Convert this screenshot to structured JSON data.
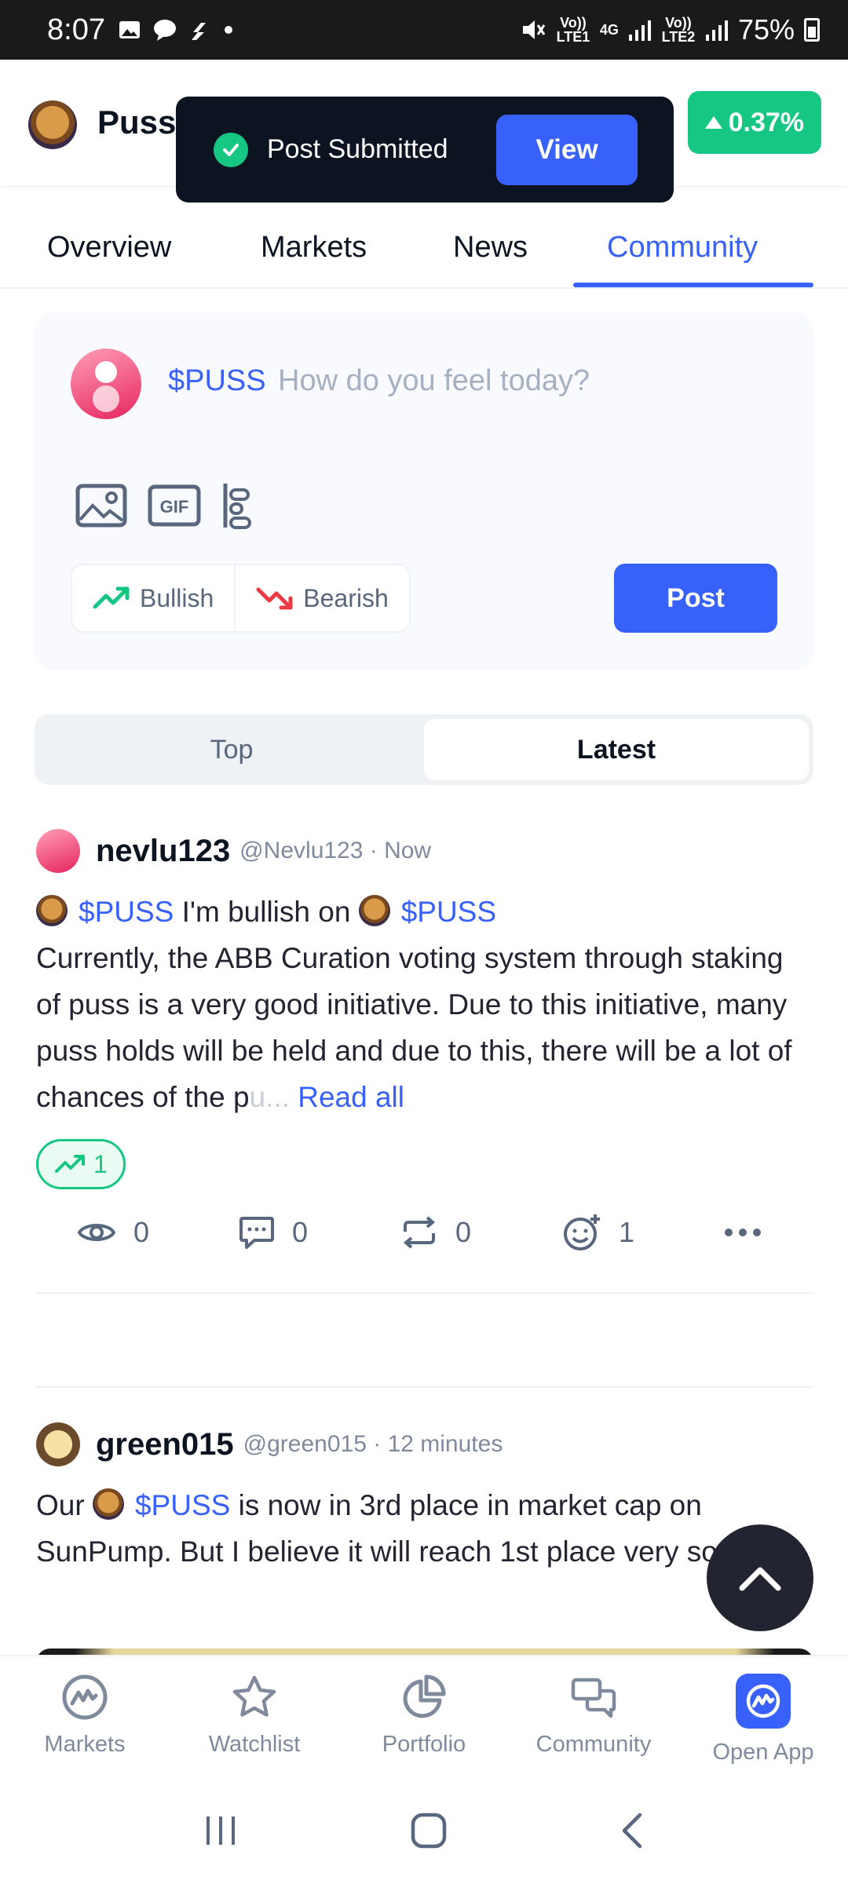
{
  "status_bar": {
    "time": "8:07",
    "signal1_label": "Vo)) LTE1",
    "net_label": "4G",
    "signal2_label": "Vo)) LTE2",
    "battery": "75%"
  },
  "header": {
    "coin_name": "Puss",
    "price_change": "0.37%",
    "change_color": "#16c784"
  },
  "toast": {
    "message": "Post Submitted",
    "action_label": "View"
  },
  "tabs": [
    "Overview",
    "Markets",
    "News",
    "Community"
  ],
  "active_tab": "Community",
  "composer": {
    "ticker": "$PUSS",
    "placeholder": "How do you feel today?",
    "bullish_label": "Bullish",
    "bearish_label": "Bearish",
    "post_label": "Post"
  },
  "feed_tabs": {
    "top": "Top",
    "latest": "Latest",
    "active": "Latest"
  },
  "posts": [
    {
      "user": "nevlu123",
      "handle": "@Nevlu123 · Now",
      "ticker1": "$PUSS",
      "mid_text": " I'm bullish on ",
      "ticker2": "$PUSS",
      "body": "Currently, the ABB Curation voting system through staking of puss is a very good initiative. Due to this initiative, many puss holds will be held and due to this, there will be a lot of chances of the p",
      "truncated": "u... ",
      "read_all": "Read all",
      "bullish_count": "1",
      "views": "0",
      "comments": "0",
      "reposts": "0",
      "reactions": "1"
    },
    {
      "user": "green015",
      "handle": "@green015 · 12 minutes",
      "pre_text": "Our ",
      "ticker": "$PUSS",
      "body": " is now in 3rd place in market cap on SunPump. But I believe it will reach 1st place very soon."
    }
  ],
  "bottom_nav": [
    "Markets",
    "Watchlist",
    "Portfolio",
    "Community",
    "Open App"
  ],
  "colors": {
    "accent": "#3861fb",
    "bullish": "#16c784",
    "bearish": "#ea3943"
  }
}
